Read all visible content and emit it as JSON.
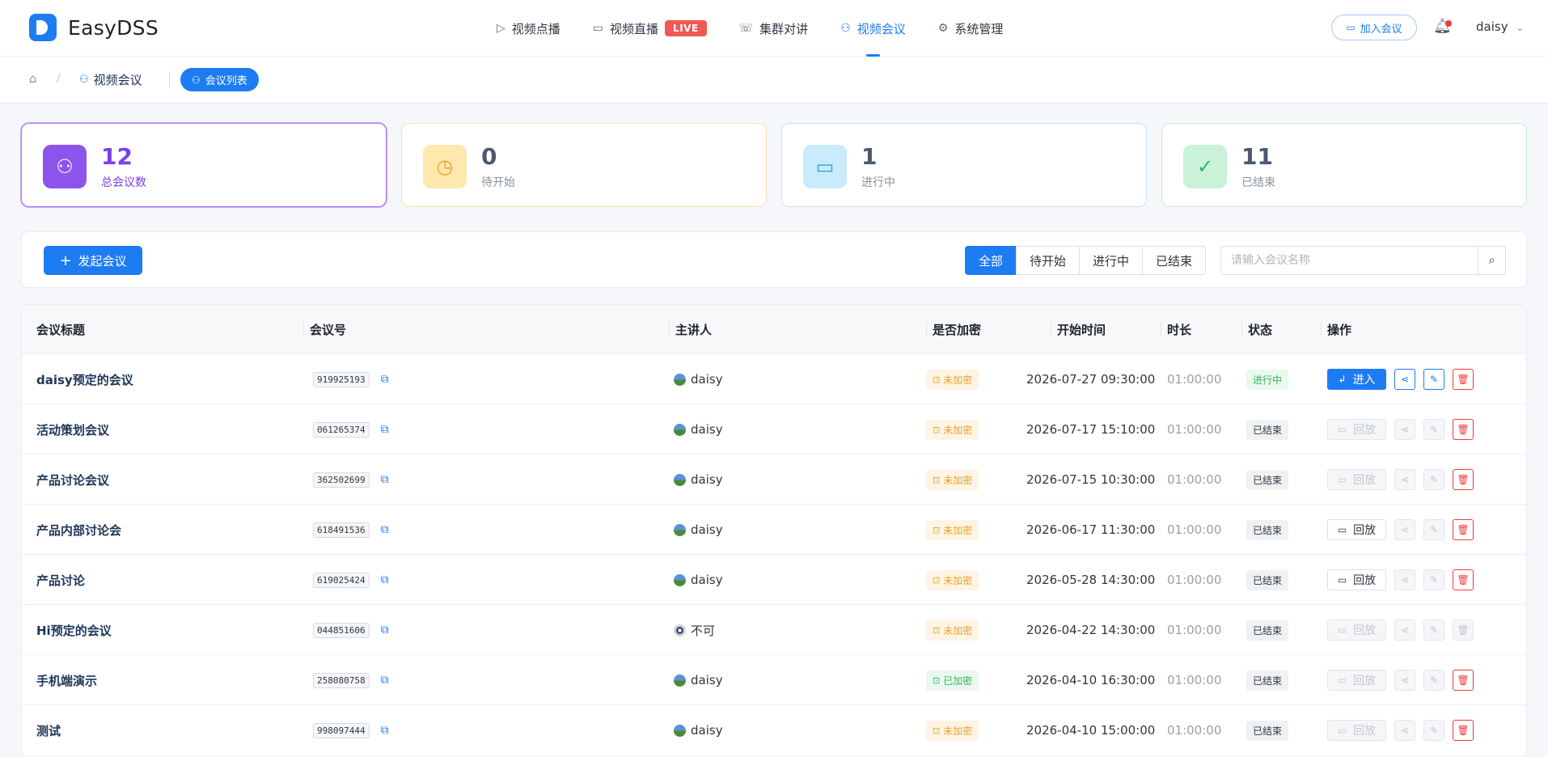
{
  "app": {
    "name": "EasyDSS"
  },
  "nav": [
    {
      "label": "视频点播",
      "icon": "play-circle-icon"
    },
    {
      "label": "视频直播",
      "icon": "video-camera-icon",
      "badge": "LIVE"
    },
    {
      "label": "集群对讲",
      "icon": "phone-icon"
    },
    {
      "label": "视频会议",
      "icon": "meeting-users-icon",
      "active": true
    },
    {
      "label": "系统管理",
      "icon": "gear-icon"
    }
  ],
  "header": {
    "join_label": "加入会议",
    "user": "daisy"
  },
  "breadcrumb": {
    "section": "视频会议",
    "current": "会议列表"
  },
  "stats": [
    {
      "value": "12",
      "label": "总会议数"
    },
    {
      "value": "0",
      "label": "待开始"
    },
    {
      "value": "1",
      "label": "进行中"
    },
    {
      "value": "11",
      "label": "已结束"
    }
  ],
  "toolbar": {
    "new_label": "发起会议",
    "filters": [
      "全部",
      "待开始",
      "进行中",
      "已结束"
    ],
    "active_filter": "全部",
    "search_placeholder": "请输入会议名称"
  },
  "table": {
    "headers": {
      "title": "会议标题",
      "number": "会议号",
      "host": "主讲人",
      "encrypted": "是否加密",
      "start": "开始时间",
      "duration": "时长",
      "status": "状态",
      "ops": "操作"
    },
    "labels": {
      "enter": "进入",
      "replay": "回放"
    },
    "rows": [
      {
        "title": "daisy预定的会议",
        "number": "919925193",
        "host": "daisy",
        "enc": "未加密",
        "start": "2026-07-27 09:30:00",
        "duration": "01:00:00",
        "status": "进行中"
      },
      {
        "title": "活动策划会议",
        "number": "061265374",
        "host": "daisy",
        "enc": "未加密",
        "start": "2026-07-17 15:10:00",
        "duration": "01:00:00",
        "status": "已结束"
      },
      {
        "title": "产品讨论会议",
        "number": "362502699",
        "host": "daisy",
        "enc": "未加密",
        "start": "2026-07-15 10:30:00",
        "duration": "01:00:00",
        "status": "已结束"
      },
      {
        "title": "产品内部讨论会",
        "number": "618491536",
        "host": "daisy",
        "enc": "未加密",
        "start": "2026-06-17 11:30:00",
        "duration": "01:00:00",
        "status": "已结束"
      },
      {
        "title": "产品讨论",
        "number": "619025424",
        "host": "daisy",
        "enc": "未加密",
        "start": "2026-05-28 14:30:00",
        "duration": "01:00:00",
        "status": "已结束"
      },
      {
        "title": "Hi预定的会议",
        "number": "044851606",
        "host": "不可",
        "enc": "未加密",
        "start": "2026-04-22 14:30:00",
        "duration": "01:00:00",
        "status": "已结束"
      },
      {
        "title": "手机端演示",
        "number": "258080758",
        "host": "daisy",
        "enc": "已加密",
        "start": "2026-04-10 16:30:00",
        "duration": "01:00:00",
        "status": "已结束"
      },
      {
        "title": "测试",
        "number": "998097444",
        "host": "daisy",
        "enc": "未加密",
        "start": "2026-04-10 15:00:00",
        "duration": "01:00:00",
        "status": "已结束"
      }
    ]
  }
}
